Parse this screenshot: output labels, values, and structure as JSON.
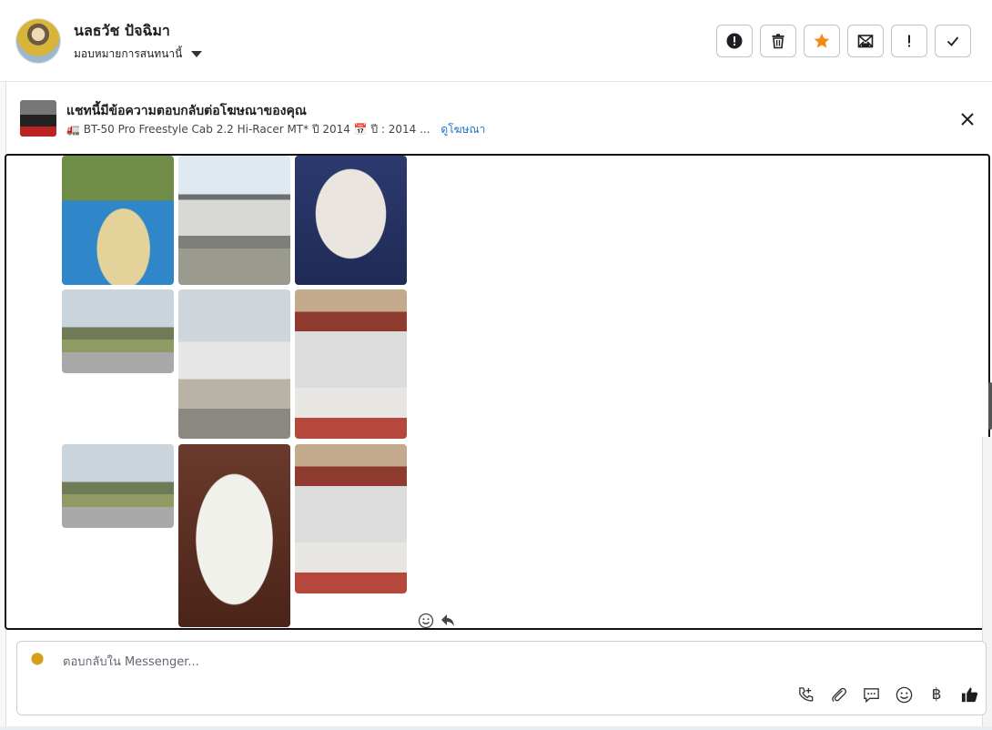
{
  "header": {
    "username": "นลธวัช ปัจฉิมา",
    "assign_label": "มอบหมายการสนทนานี้",
    "actions": [
      {
        "name": "report-button",
        "icon": "alert-circle-icon"
      },
      {
        "name": "delete-button",
        "icon": "trash-icon"
      },
      {
        "name": "star-button",
        "icon": "star-icon"
      },
      {
        "name": "mark-unread-button",
        "icon": "envelope-icon"
      },
      {
        "name": "priority-button",
        "icon": "exclamation-icon"
      },
      {
        "name": "done-button",
        "icon": "checkmark-icon"
      }
    ]
  },
  "ad_banner": {
    "title": "แชทนี้มีข้อความตอบกลับต่อโฆษณาของคุณ",
    "subtitle": "🚛 BT-50 Pro Freestyle Cab 2.2 Hi-Racer MT* ปี 2014 📅 ปี : 2014 ...",
    "link": "ดูโฆษณา"
  },
  "photos": [
    {
      "name": "photo-rice-drying",
      "alt": "rice drying"
    },
    {
      "name": "photo-roadside-stall",
      "alt": "roadside stall"
    },
    {
      "name": "photo-id-card",
      "alt": "id card"
    },
    {
      "name": "photo-truck-field",
      "alt": "truck"
    },
    {
      "name": "photo-truck-tank",
      "alt": "truck with tank"
    },
    {
      "name": "photo-shop-woman",
      "alt": "shop"
    },
    {
      "name": "photo-truck-field-2",
      "alt": "truck"
    },
    {
      "name": "photo-document",
      "alt": "document"
    },
    {
      "name": "photo-shop-woman-2",
      "alt": "shop"
    }
  ],
  "composer": {
    "placeholder": "ตอบกลับใน Messenger...",
    "baht_symbol": "฿"
  },
  "colors": {
    "star": "#f28a1a",
    "link": "#1a73c8",
    "border": "#111111"
  }
}
